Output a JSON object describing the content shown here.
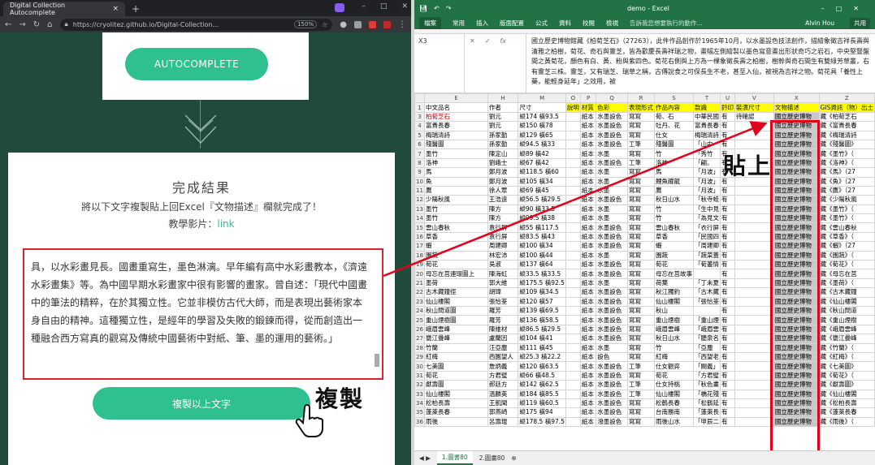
{
  "browser": {
    "tab_title": "Digital Collection Autocomplete",
    "tab_close": "×",
    "new_tab": "+",
    "url": "https://cryolitez.github.io/Digital-Collection...",
    "zoom": "150%",
    "win_min": "–",
    "win_max": "□",
    "win_close": "✕"
  },
  "page": {
    "autocomplete_button": "AUTOCOMPLETE",
    "result_title": "完成結果",
    "result_desc": "將以下文字複製貼上回Excel『文物描述』欄就完成了！",
    "video_prefix": "教學影片：",
    "video_link": "link",
    "textbox_content": "具，以水彩畫見長。國畫重寫生，墨色淋漓。早年編有高中水彩畫教本，《濟遠水彩畫集》等。為中國早期水彩畫家中很有影響的畫家。曾自述：「現代中國畫中的筆法的精粹，在於其獨立性。它並非模仿古代大師，而是表現出藝術家本身自由的精神。這種獨立性，是經年的學習及失敗的鍛鍊而得，從而創造出一種融合西方寫真的觀寫及傳統中國藝術中對紙、筆、墨的運用的藝術。」",
    "copy_button": "複製以上文字",
    "copy_annotation": "複製"
  },
  "excel": {
    "title": "demo - Excel",
    "user": "Alvin Hou",
    "ribbon_tabs": [
      "檔案",
      "常用",
      "插入",
      "版面配置",
      "公式",
      "資料",
      "校閱",
      "檢視"
    ],
    "tell_me": "告訴我您想要執行的動作...",
    "share": "共用",
    "name_box": "X3",
    "formula_text": "國立歷史博物館藏《柏荀芝石》（27263），此件作品創作於1965年10月，以水墨設色技法創作，描繪象徵吉祥長壽與清雅之柏樹，荀花、奇石與靈芝，皆為歡慶長壽祥瑞之物，畫幅左側繪製以墨色寫意畫出形狀奇巧之岩石，中央堅豎盤間之黃荀花，顏色有白、黃、粉與紫四色。荀花右側與上方為一棵象徵長壽之柏樹，樹幹與奇石間生有雙綠芳草叢，右有靈芝三株。靈芝，又有瑞芝、瑞草之稱，古傳說食之可保長生不老，甚至入仙，被視為吉祥之物。荀花具「養性上藥，能輕身延年」之效用，被",
    "columns": [
      "E",
      "H",
      "M",
      "O",
      "P",
      "Q",
      "R",
      "S",
      "T",
      "U",
      "V",
      "X",
      "Z"
    ],
    "headers": [
      "中文品名",
      "作者",
      "尺寸",
      "說明",
      "材質",
      "色彩",
      "表現形式",
      "作品內容",
      "款識",
      "鈐印",
      "裝潢尺寸",
      "文物描述",
      "GIS資訊（物）出土"
    ],
    "rows": [
      [
        "柏荀芝石",
        "劉元",
        "縱174 橫93.5",
        "",
        "紙本",
        "水墨設色",
        "寫寫",
        "荀、石",
        "中華民國",
        "有",
        "待確認",
        "國立歷史博物",
        "藏《柏荀芝石"
      ],
      [
        "富貴長春",
        "劉元",
        "縱150 橫78",
        "",
        "紙本",
        "水墨設色",
        "寫寫",
        "牡丹、花",
        "富貴長春",
        "有",
        "",
        "國立歷史博物",
        "藏《富貴長春"
      ],
      [
        "梅瑞清詩",
        "孫家勤",
        "縱129 橫65",
        "",
        "紙本",
        "水墨設色",
        "寫寫",
        "仕女",
        "梅瑞清詩",
        "有",
        "",
        "國立歷史博物",
        "藏《梅瑞清詩"
      ],
      [
        "殘醫圖",
        "孫家勤",
        "縱94.5 橫33",
        "",
        "紙本",
        "水墨設色",
        "工筆",
        "殘醫圖",
        "「山中",
        "有",
        "",
        "國立歷史博物",
        "藏《殘醫圖》"
      ],
      [
        "墨竹",
        "陳定山",
        "縱89 橫42",
        "",
        "紙本",
        "水墨",
        "寫寫",
        "竹",
        "「秀竹",
        "有",
        "",
        "國立歷史博物",
        "藏《墨竹》（"
      ],
      [
        "洛神",
        "劉峨士",
        "縱67 橫42",
        "",
        "紙本",
        "水墨設色",
        "工筆",
        "洛神",
        "「翩。",
        "有",
        "",
        "國立歷史博物",
        "藏《洛神》（"
      ],
      [
        "馬",
        "鄭月波",
        "縱118.5 橫60",
        "",
        "紙本",
        "水墨",
        "寫寫",
        "馬",
        "「月波」",
        "有",
        "",
        "國立歷史博物",
        "藏《馬》（27"
      ],
      [
        "魚",
        "鄭月波",
        "縱105 橫34",
        "",
        "紙本",
        "水墨",
        "寫寫",
        "鯉魚躍龍",
        "「月波」",
        "有",
        "",
        "國立歷史博物",
        "藏《魚》（27"
      ],
      [
        "鷹",
        "徐人眾",
        "縱69 橫45",
        "",
        "紙本",
        "水墨",
        "寫寫",
        "鷹",
        "「月波」",
        "有",
        "",
        "國立歷史博物",
        "藏《鷹》（27"
      ],
      [
        "少陽秋風",
        "王浩遠",
        "縱56.5 橫29.5",
        "",
        "紙本",
        "水墨設色",
        "寫寫",
        "秋日山水",
        "「秋寺蛙",
        "有",
        "",
        "國立歷史博物",
        "藏《少陽秋風"
      ],
      [
        "墨竹",
        "陳方",
        "縱90 橫33.5",
        "",
        "紙本",
        "水墨",
        "寫寫",
        "竹",
        "「生中見",
        "有",
        "",
        "國立歷史博物",
        "藏《墨竹》（"
      ],
      [
        "墨竹",
        "陳方",
        "縱99.5 橫38",
        "",
        "紙本",
        "水墨",
        "寫寫",
        "竹",
        "「為見文",
        "有",
        "",
        "國立歷史博物",
        "藏《墨竹》（"
      ],
      [
        "雲山春秋",
        "袁行屏",
        "縱55 橫117.5",
        "",
        "紙本",
        "水墨設色",
        "寫寫",
        "雲山春秋",
        "「衣行屏",
        "有",
        "",
        "國立歷史博物",
        "藏《雲山春秋"
      ],
      [
        "草香",
        "袁行屏",
        "縱83.5 橫43",
        "",
        "紙本",
        "水墨設色",
        "寫寫",
        "草香",
        "「民國四",
        "有",
        "",
        "國立歷史博物",
        "藏《草香》（"
      ],
      [
        "蝦",
        "周建卿",
        "縱100 橫34",
        "",
        "紙本",
        "水墨設色",
        "寫寫",
        "蝦",
        "「周建卿",
        "有",
        "",
        "國立歷史博物",
        "藏《蝦》（27"
      ],
      [
        "園蔬",
        "林宏沛",
        "縱100 橫44",
        "",
        "紙本",
        "水墨",
        "寫寫",
        "園蔬",
        "「蔬菜蓋",
        "有",
        "",
        "國立歷史博物",
        "藏《園蔬》（"
      ],
      [
        "荀花",
        "吳淑",
        "縱137 橫64",
        "",
        "紙本",
        "水墨設色",
        "寫寫",
        "荀花",
        "「荀叢情",
        "有",
        "",
        "國立歷史博物",
        "藏《荀花》（"
      ],
      [
        "母忘在莒連環圖上",
        "陳海虹",
        "縱33.5 橫33.5",
        "",
        "紙本",
        "水墨設色",
        "寫寫",
        "母忘在莒故事",
        "",
        "有",
        "",
        "國立歷史博物",
        "藏《母忘在莒"
      ],
      [
        "墨荷",
        "郭大維",
        "縱175.5 橫92.5",
        "",
        "紙本",
        "水墨",
        "寫寫",
        "荷葉",
        "「丁未夏",
        "有",
        "",
        "國立歷史博物",
        "藏《墨荷》（"
      ],
      [
        "古木藏鐘徑",
        "胡璋",
        "縱109 橫34.5",
        "",
        "紙本",
        "水墨設色",
        "寫寫",
        "秋江獨釣",
        "「古木藏",
        "有",
        "",
        "國立歷史博物",
        "藏《古木藏鐘"
      ],
      [
        "仙山樓閣",
        "張恰荃",
        "縱120 橫57",
        "",
        "紙本",
        "水墨設色",
        "寫寫",
        "仙山樓閣",
        "「張恰荃",
        "有",
        "",
        "國立歷史博物",
        "藏《仙山樓閣"
      ],
      [
        "秋山問道圖",
        "羅芳",
        "縱139 橫69.5",
        "",
        "紙本",
        "水墨設色",
        "寫寫",
        "秋山",
        "",
        "有",
        "",
        "國立歷史博物",
        "藏《秋山問道"
      ],
      [
        "重山煙樹圖",
        "羅芳",
        "縱136 橫58.5",
        "",
        "紙本",
        "水墨設色",
        "寫寫",
        "重山煙樹",
        "「重山煙",
        "有",
        "",
        "國立歷史博物",
        "藏《重山煙樹"
      ],
      [
        "峨眉雲峰",
        "陳維材",
        "縱86.5 橫29.5",
        "",
        "紙本",
        "水墨設色",
        "寫寫",
        "峨眉雲峰",
        "「峨眉雲",
        "有",
        "",
        "國立歷史博物",
        "藏《峨眉雲峰"
      ],
      [
        "甕江疊峰",
        "盧蘭因",
        "縱104 橫41",
        "",
        "紙本",
        "水墨設色",
        "寫寫",
        "秋日山水",
        "「聽泉名",
        "有",
        "",
        "國立歷史博物",
        "藏《甕江疊峰"
      ],
      [
        "竹蘭",
        "汪亞塵",
        "縱111 橫45",
        "",
        "紙本",
        "水墨",
        "寫寫",
        "竹",
        "「亞塵",
        "有",
        "",
        "國立歷史博物",
        "藏《竹蘭》（"
      ],
      [
        "紅梅",
        "西園望人",
        "縱25.3 橫22.2",
        "",
        "紙本",
        "設色",
        "寫寫",
        "紅梅",
        "「西望老",
        "有",
        "",
        "國立歷史博物",
        "藏《紅梅》（"
      ],
      [
        "七美圖",
        "詹炳義",
        "縱120 橫63.5",
        "",
        "紙本",
        "水墨設色",
        "工筆",
        "仕女觀弈",
        "「闕義」",
        "有",
        "",
        "國立歷史博物",
        "藏《七美圖》"
      ],
      [
        "荀花",
        "方君璧",
        "縱66 橫48.5",
        "",
        "紙本",
        "水墨設色",
        "寫寫",
        "荀花",
        "「方君璧",
        "有",
        "",
        "國立歷史博物",
        "藏《荀花》（"
      ],
      [
        "獻壽圖",
        "郝廷方",
        "縱142 橫62.5",
        "",
        "紙本",
        "水墨設色",
        "工筆",
        "仕女持桃",
        "「秋色畫",
        "有",
        "",
        "國立歷史博物",
        "藏《獻壽圖》"
      ],
      [
        "仙山樓閣",
        "溫麟英",
        "縱184 橫85.5",
        "",
        "紙本",
        "水墨設色",
        "工筆",
        "仙山樓閣",
        "「橋花殘",
        "有",
        "",
        "國立歷史博物",
        "藏《仙山樓閣"
      ],
      [
        "松柏長壽",
        "王凱聞",
        "縱119 橫60.5",
        "",
        "紙本",
        "水墨設色",
        "寫寫",
        "松鶴長春",
        "「松鶴延",
        "有",
        "",
        "國立歷史博物",
        "藏《松柏長壽"
      ],
      [
        "蓬萊長春",
        "郭燕崎",
        "縱175 橫94",
        "",
        "紙本",
        "水墨設色",
        "寫寫",
        "台南勝南",
        "「蓬萊長",
        "有",
        "",
        "國立歷史博物",
        "藏《蓬萊長春"
      ],
      [
        "雨後",
        "呂壽琨",
        "縱178.5 橫97.5",
        "",
        "紙本",
        "潑墨設色",
        "寫寫",
        "雨後山水",
        "「甲辰二",
        "有",
        "",
        "國立歷史博物",
        "藏《雨後》（"
      ]
    ],
    "sheet_tabs": [
      "1.圖書80",
      "2.圖畫80"
    ],
    "paste_annotation": "貼上"
  }
}
